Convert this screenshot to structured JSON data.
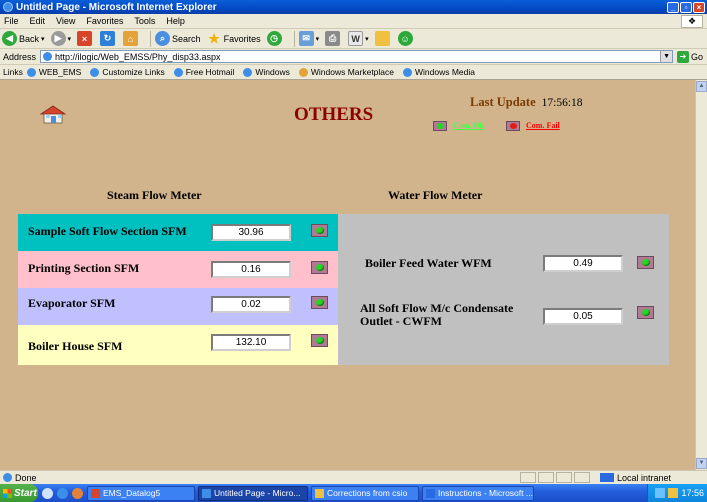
{
  "window": {
    "title": "Untitled Page - Microsoft Internet Explorer"
  },
  "menu": [
    "File",
    "Edit",
    "View",
    "Favorites",
    "Tools",
    "Help"
  ],
  "toolbar": {
    "back": "Back",
    "search": "Search",
    "favorites": "Favorites"
  },
  "address": {
    "label": "Address",
    "url": "http://ilogic/Web_EMSS/Phy_disp33.aspx",
    "go": "Go"
  },
  "links": {
    "label": "Links",
    "items": [
      "WEB_EMS",
      "Customize Links",
      "Free Hotmail",
      "Windows",
      "Windows Marketplace",
      "Windows Media"
    ]
  },
  "page": {
    "title": "OTHERS",
    "last_update_label": "Last Update",
    "last_update_time": "17:56:18",
    "com_ok": "Com. Ok",
    "com_fail": "Com. Fail",
    "steam": {
      "title": "Steam Flow Meter",
      "rows": [
        {
          "label": "Sample Soft Flow Section SFM",
          "value": "30.96",
          "color": "#00c0c0"
        },
        {
          "label": "Printing Section SFM",
          "value": "0.16",
          "color": "#ffc0cb"
        },
        {
          "label": "Evaporator SFM",
          "value": "0.02",
          "color": "#c0c0ff"
        },
        {
          "label": "Boiler House SFM",
          "value": "132.10",
          "color": "#ffffc0"
        }
      ]
    },
    "water": {
      "title": "Water Flow Meter",
      "rows": [
        {
          "label": "Boiler Feed Water WFM",
          "value": "0.49"
        },
        {
          "label": "All Soft Flow M/c Condensate Outlet - CWFM",
          "value": "0.05"
        }
      ]
    }
  },
  "status": {
    "text": "Done",
    "zone": "Local intranet"
  },
  "taskbar": {
    "start": "Start",
    "tasks": [
      "EMS_Datalog5",
      "Untitled Page - Micro...",
      "Corrections from csio",
      "Instructions - Microsoft ..."
    ],
    "clock": "17:56"
  }
}
